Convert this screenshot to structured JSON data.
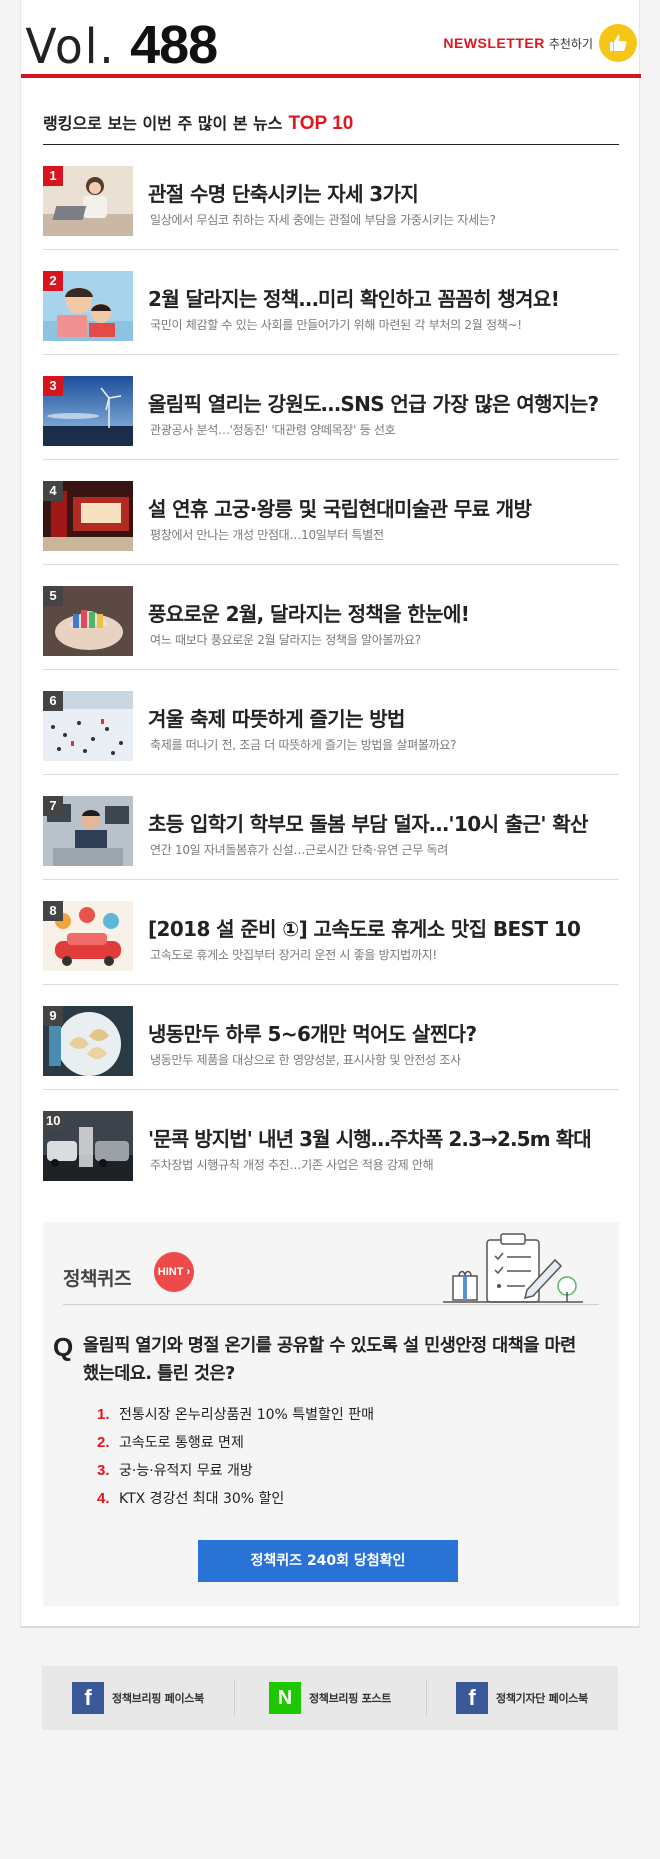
{
  "header": {
    "vol_prefix": "Vol.",
    "vol_number": "488",
    "newsletter_word": "NEWSLETTER",
    "recommend_label": "추천하기"
  },
  "ranking": {
    "title": "랭킹으로 보는 이번 주 많이 본 뉴스",
    "highlight": "TOP 10",
    "items": [
      {
        "rank": "1",
        "title": "관절 수명 단축시키는 자세 3가지",
        "summary": "일상에서 무심코 취하는 자세 중에는 관절에 부담을 가중시키는 자세는?"
      },
      {
        "rank": "2",
        "title": "2월 달라지는 정책…미리 확인하고 꼼꼼히 챙겨요!",
        "summary": "국민이 체감할 수 있는 사회를 만들어가기 위해 마련된 각 부처의 2월 정책~!"
      },
      {
        "rank": "3",
        "title": "올림픽 열리는 강원도…SNS 언급 가장 많은 여행지는?",
        "summary": "관광공사 분석…'정동진' '대관령 양떼목장' 등 선호"
      },
      {
        "rank": "4",
        "title": "설 연휴 고궁·왕릉 및 국립현대미술관 무료 개방",
        "summary": "평창에서 만나는 개성 만점대…10일부터 특별전"
      },
      {
        "rank": "5",
        "title": "풍요로운 2월, 달라지는 정책을 한눈에!",
        "summary": "여느 때보다 풍요로운 2월 달라지는 정책을 알아볼까요?"
      },
      {
        "rank": "6",
        "title": "겨울 축제 따뜻하게 즐기는 방법",
        "summary": "축제를 떠나기 전, 조금 더 따뜻하게 즐기는 방법을 살펴볼까요?"
      },
      {
        "rank": "7",
        "title": "초등 입학기 학부모 돌봄 부담 덜자…'10시 출근' 확산",
        "summary": "연간 10일 자녀돌봄휴가 신설…근로시간 단축·유연 근무 독려"
      },
      {
        "rank": "8",
        "title": "[2018 설 준비 ①] 고속도로 휴게소 맛집 BEST 10",
        "summary": "고속도로 휴게소 맛집부터 장거리 운전 시 좋을 방지법까지!"
      },
      {
        "rank": "9",
        "title": "냉동만두 하루 5~6개만 먹어도 살찐다?",
        "summary": "냉동만두 제품을 대상으로 한 영양성분, 표시사항 및 안전성 조사"
      },
      {
        "rank": "10",
        "title": "'문콕 방지법' 내년 3월 시행…주차폭 2.3→2.5m 확대",
        "summary": "주차장법 시행규칙 개정 추진…기존 사업은 적용 강제 안해"
      }
    ]
  },
  "quiz": {
    "title": "정책퀴즈",
    "hint_label": "HINT",
    "question_mark": "Q",
    "question": "올림픽 열기와 명절 온기를 공유할 수 있도록 설 민생안정 대책을 마련했는데요. 틀린 것은?",
    "options": [
      {
        "num": "1.",
        "text": "전통시장 온누리상품권 10% 특별할인 판매"
      },
      {
        "num": "2.",
        "text": "고속도로 통행료 면제"
      },
      {
        "num": "3.",
        "text": "궁·능·유적지 무료 개방"
      },
      {
        "num": "4.",
        "text": "KTX 경강선 최대 30% 할인"
      }
    ],
    "button_label": "정책퀴즈 240회 당첨확인"
  },
  "footer": {
    "links": [
      {
        "icon_text": "f",
        "label": "정책브리핑 페이스북",
        "icon": "facebook-icon"
      },
      {
        "icon_text": "N",
        "label": "정책브리핑 포스트",
        "icon": "naver-icon"
      },
      {
        "icon_text": "f",
        "label": "정책기자단 페이스북",
        "icon": "facebook-icon"
      }
    ]
  },
  "colors": {
    "accent_red": "#d8151d",
    "quiz_button_blue": "#2a73d6",
    "hint_red": "#ef4a4a",
    "facebook_blue": "#3b5998",
    "naver_green": "#1ec800"
  }
}
